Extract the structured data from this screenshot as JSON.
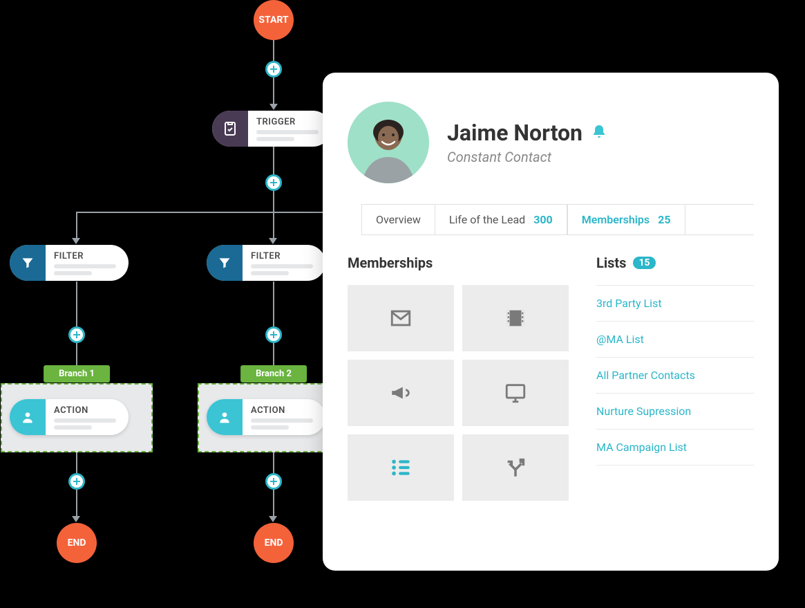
{
  "flow": {
    "start_label": "START",
    "end_label": "END",
    "trigger_label": "TRIGGER",
    "filter_label": "FILTER",
    "action_label": "ACTION",
    "branch1_label": "Branch 1",
    "branch2_label": "Branch 2"
  },
  "contact": {
    "name": "Jaime Norton",
    "company": "Constant Contact",
    "tabs": {
      "overview": "Overview",
      "life_of_lead": "Life of the Lead",
      "life_of_lead_count": "300",
      "memberships": "Memberships",
      "memberships_count": "25"
    },
    "sections": {
      "memberships_title": "Memberships",
      "lists_title": "Lists",
      "lists_count": "15"
    },
    "membership_tiles": [
      {
        "name": "email-icon"
      },
      {
        "name": "film-icon"
      },
      {
        "name": "bullhorn-icon"
      },
      {
        "name": "monitor-icon"
      },
      {
        "name": "list-icon"
      },
      {
        "name": "split-icon"
      }
    ],
    "lists": [
      "3rd Party List",
      "@MA List",
      "All Partner Contacts",
      "Nurture Supression",
      "MA Campaign List"
    ]
  },
  "colors": {
    "orange": "#f4623a",
    "teal": "#2bb6c9",
    "green": "#6ab43f",
    "purple": "#4a3b55",
    "blue": "#1a6a95"
  }
}
